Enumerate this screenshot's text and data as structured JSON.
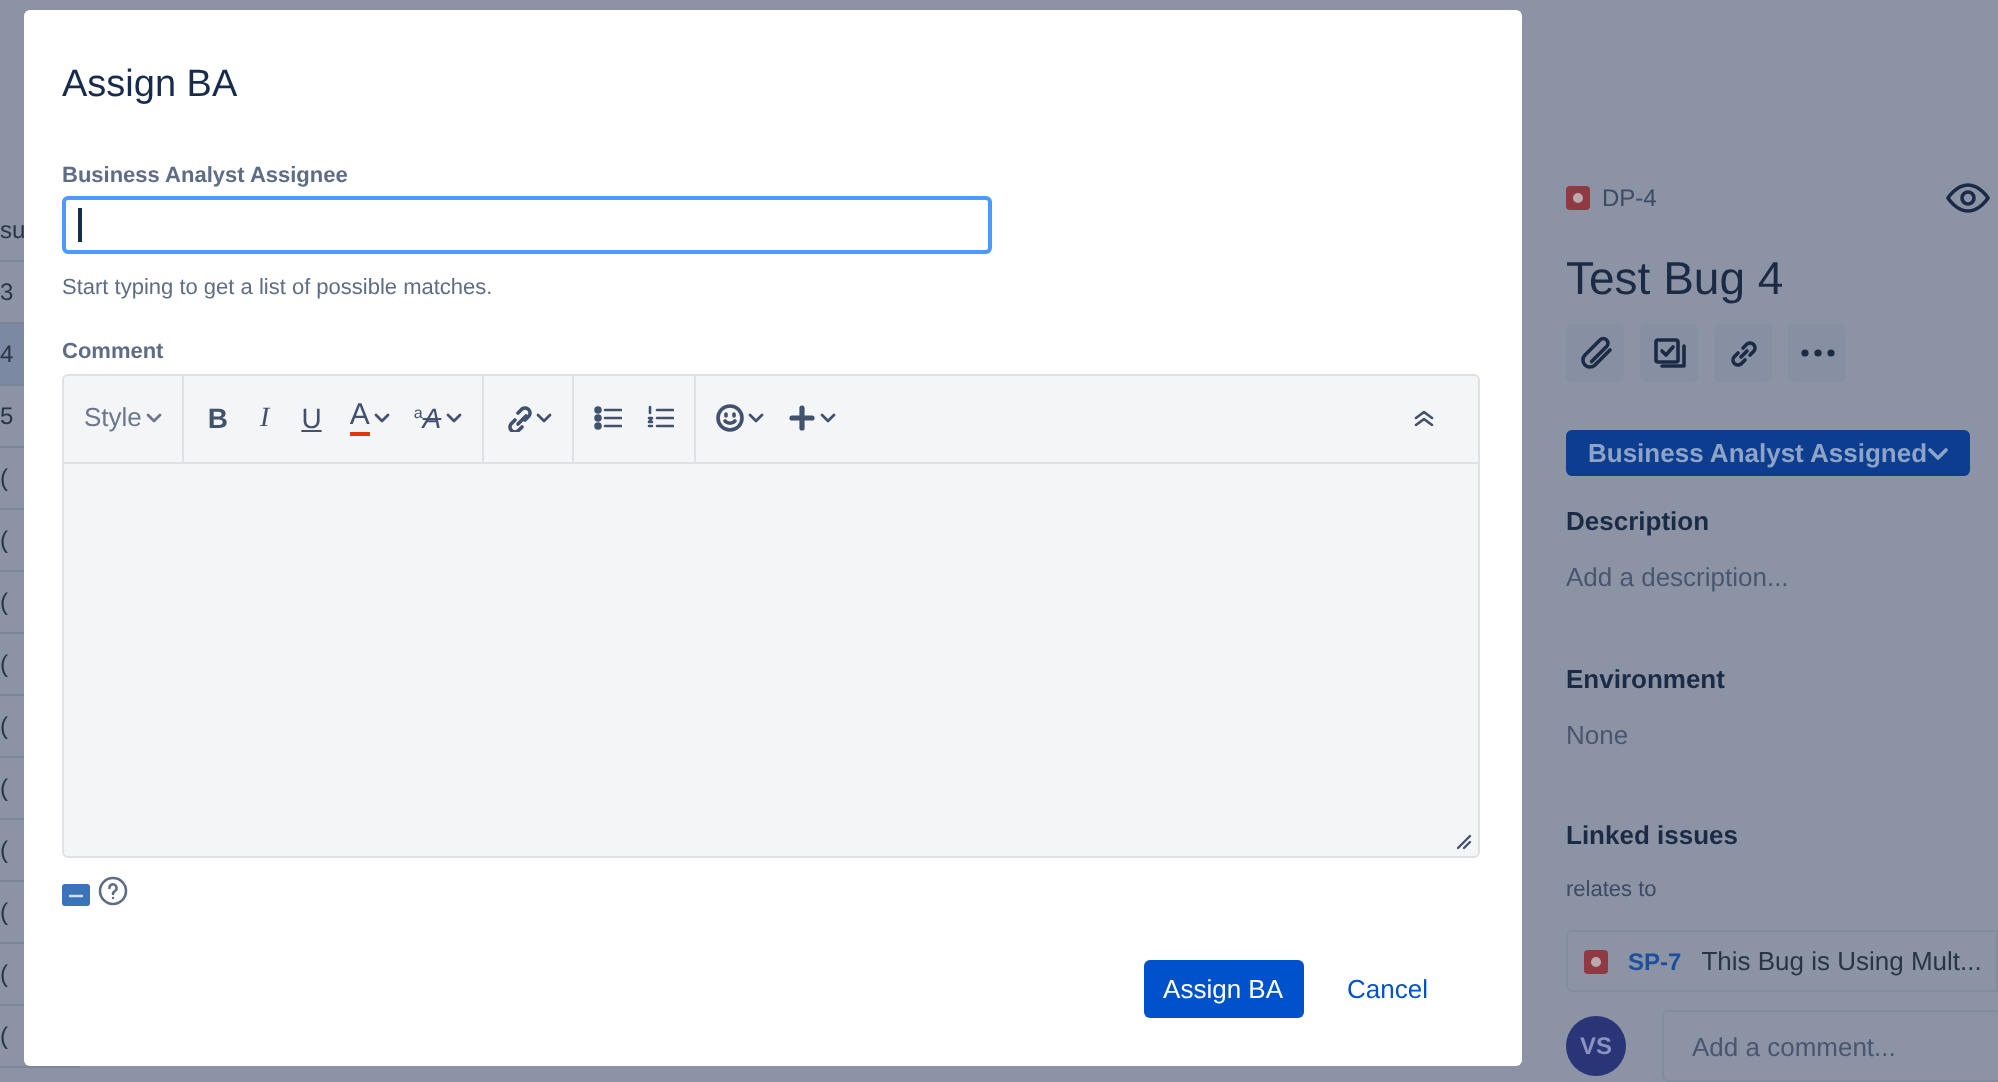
{
  "background_list": {
    "rows": [
      {
        "text": "su",
        "selected": false
      },
      {
        "text": "3",
        "selected": false
      },
      {
        "text": "4",
        "selected": true
      },
      {
        "text": "5",
        "selected": false
      },
      {
        "text": "(",
        "selected": false
      },
      {
        "text": "(",
        "selected": false
      },
      {
        "text": "(",
        "selected": false
      },
      {
        "text": "(",
        "selected": false
      },
      {
        "text": "(",
        "selected": false
      },
      {
        "text": "(",
        "selected": false
      },
      {
        "text": "(",
        "selected": false
      },
      {
        "text": "(",
        "selected": false
      },
      {
        "text": "(",
        "selected": false
      },
      {
        "text": "(",
        "selected": false
      }
    ]
  },
  "issue_panel": {
    "key": "DP-4",
    "title": "Test Bug 4",
    "status_button": "Business Analyst Assigned",
    "sections": [
      {
        "heading": "Description",
        "value": "Add a description..."
      },
      {
        "heading": "Environment",
        "value": "None"
      }
    ],
    "linked_issues": {
      "heading": "Linked issues",
      "relation": "relates to",
      "items": [
        {
          "key": "SP-7",
          "summary": "This Bug is Using Mult..."
        }
      ]
    },
    "comment": {
      "avatar": "VS",
      "placeholder": "Add a comment..."
    }
  },
  "dialog": {
    "title": "Assign BA",
    "assignee_field": {
      "label": "Business Analyst Assignee",
      "hint": "Start typing to get a list of possible matches.",
      "focused": true
    },
    "comment": {
      "label": "Comment",
      "toolbar": [
        [
          {
            "kind": "style",
            "label": "Style"
          }
        ],
        [
          {
            "kind": "bold",
            "label": "B"
          },
          {
            "kind": "italic",
            "label": "I"
          },
          {
            "kind": "underline",
            "label": "U"
          },
          {
            "kind": "color",
            "label": "A"
          },
          {
            "kind": "effects",
            "label": "A",
            "sup": "a"
          }
        ],
        [
          {
            "kind": "link"
          }
        ],
        [
          {
            "kind": "bullets"
          },
          {
            "kind": "numbers"
          }
        ],
        [
          {
            "kind": "emoji"
          },
          {
            "kind": "insert"
          }
        ]
      ]
    },
    "buttons": [
      {
        "label": "Assign BA",
        "kind": "primary"
      },
      {
        "label": "Cancel",
        "kind": "link"
      }
    ]
  }
}
